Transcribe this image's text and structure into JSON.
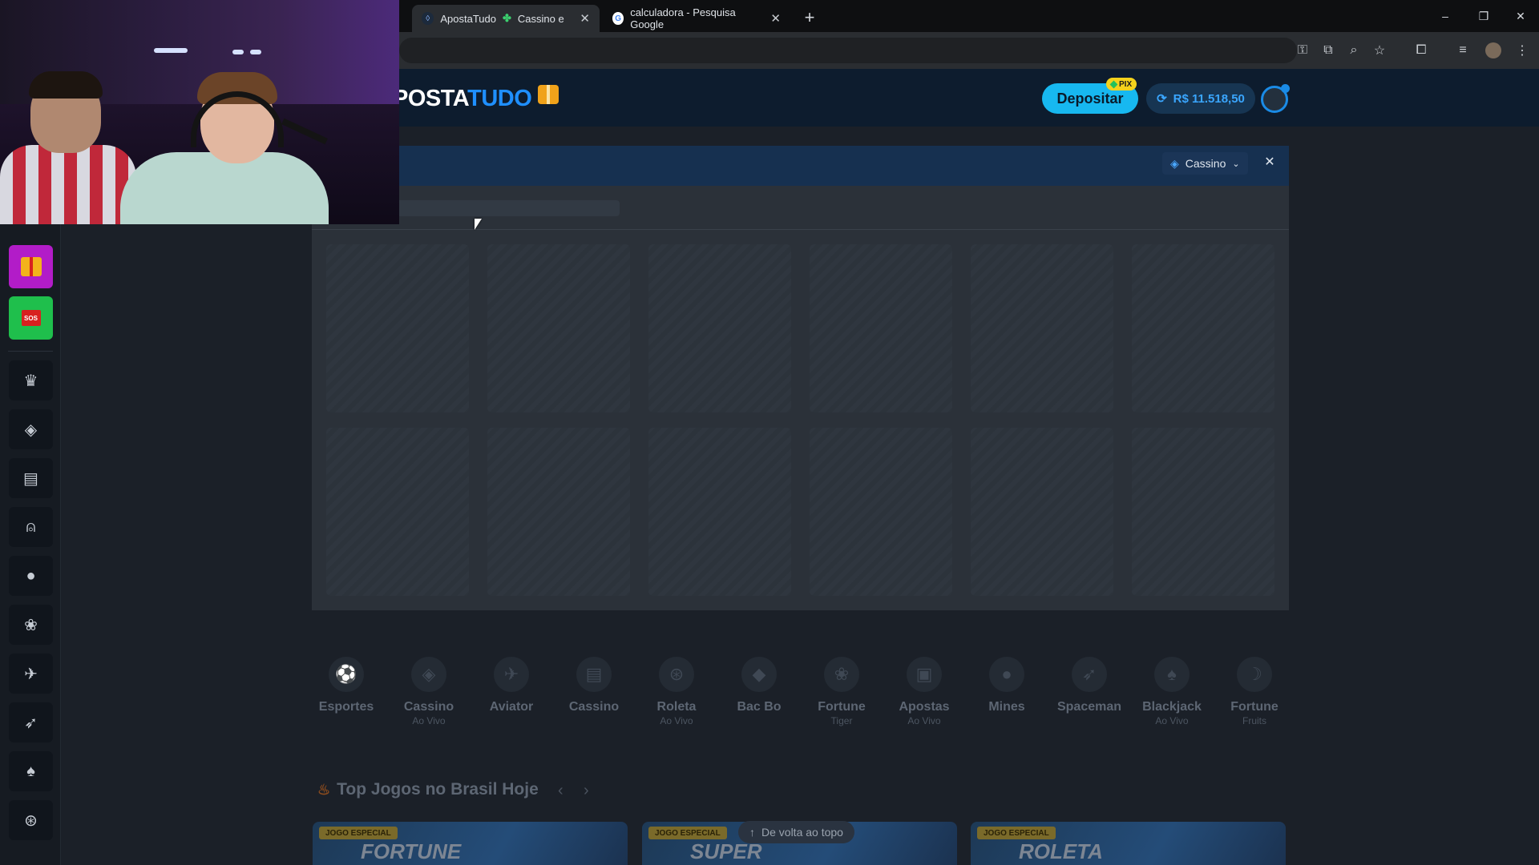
{
  "browser": {
    "tabs": [
      {
        "title": "ApostaTudo",
        "title_extra": "Cassino e Apo",
        "active": true
      },
      {
        "title": "calculadora - Pesquisa Google",
        "active": false
      }
    ],
    "new_tab": "+",
    "window_controls": {
      "minimize": "–",
      "restore": "❐",
      "close": "✕"
    }
  },
  "site": {
    "logo_left": "POSTA",
    "logo_right": "TUDO",
    "deposit_label": "Depositar",
    "pix_label": "PIX",
    "balance": "R$ 11.518,50"
  },
  "sidebar": {
    "sos_label": "SOS",
    "icons": [
      "crown-icon",
      "casino-chip-icon",
      "cards-icon",
      "joystick-icon",
      "bomb-icon",
      "paw-icon",
      "plane-icon",
      "rocket-icon",
      "blackjack-card-icon",
      "roulette-icon"
    ]
  },
  "panel": {
    "category_select": "Cassino"
  },
  "categories": [
    {
      "title": "Esportes",
      "sub": ""
    },
    {
      "title": "Cassino",
      "sub": "Ao Vivo"
    },
    {
      "title": "Aviator",
      "sub": ""
    },
    {
      "title": "Cassino",
      "sub": ""
    },
    {
      "title": "Roleta",
      "sub": "Ao Vivo"
    },
    {
      "title": "Bac Bo",
      "sub": ""
    },
    {
      "title": "Fortune",
      "sub": "Tiger"
    },
    {
      "title": "Apostas",
      "sub": "Ao Vivo"
    },
    {
      "title": "Mines",
      "sub": ""
    },
    {
      "title": "Spaceman",
      "sub": ""
    },
    {
      "title": "Blackjack",
      "sub": "Ao Vivo"
    },
    {
      "title": "Fortune",
      "sub": "Fruits"
    }
  ],
  "top_games": {
    "title": "Top Jogos no Brasil Hoje",
    "banners": [
      {
        "tag": "JOGO ESPECIAL",
        "name": "FORTUNE"
      },
      {
        "tag": "JOGO ESPECIAL",
        "name": "SUPER"
      },
      {
        "tag": "JOGO ESPECIAL",
        "name": "ROLETA"
      }
    ],
    "back_to_top": "De volta ao topo"
  }
}
